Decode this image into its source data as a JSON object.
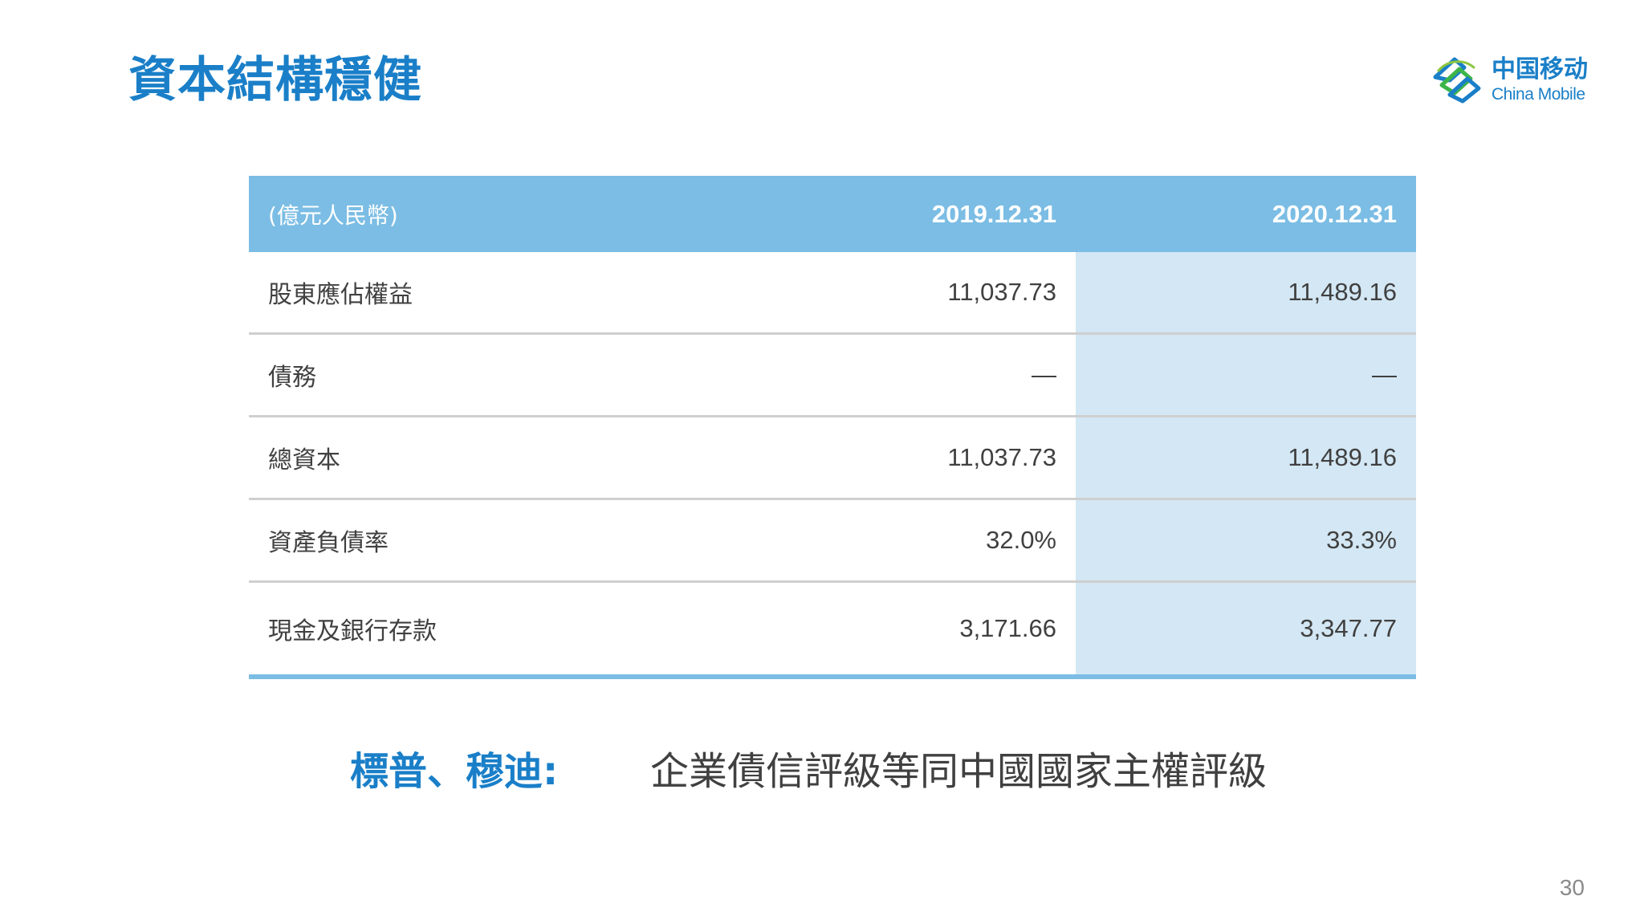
{
  "slide": {
    "title": "資本結構穩健",
    "page_number": "30"
  },
  "logo": {
    "mark_icon": "china-mobile-logo-icon",
    "name_cn": "中国移动",
    "name_en": "China Mobile",
    "brand_color": "#1a7fc8"
  },
  "table": {
    "unit_label": "(億元人民幣)",
    "columns": [
      "2019.12.31",
      "2020.12.31"
    ],
    "rows": [
      {
        "label": "股東應佔權益",
        "v2019": "11,037.73",
        "v2020": "11,489.16"
      },
      {
        "label": "債務",
        "v2019": "—",
        "v2020": "—"
      },
      {
        "label": "總資本",
        "v2019": "11,037.73",
        "v2020": "11,489.16"
      },
      {
        "label": "資產負債率",
        "v2019": "32.0%",
        "v2020": "33.3%"
      },
      {
        "label": "現金及銀行存款",
        "v2019": "3,171.66",
        "v2020": "3,347.77"
      }
    ],
    "header_color": "#7bbde4",
    "highlight_column_color": "#d3e7f4"
  },
  "rating": {
    "label": "標普、穆迪:",
    "text": "企業債信評級等同中國國家主權評級"
  }
}
